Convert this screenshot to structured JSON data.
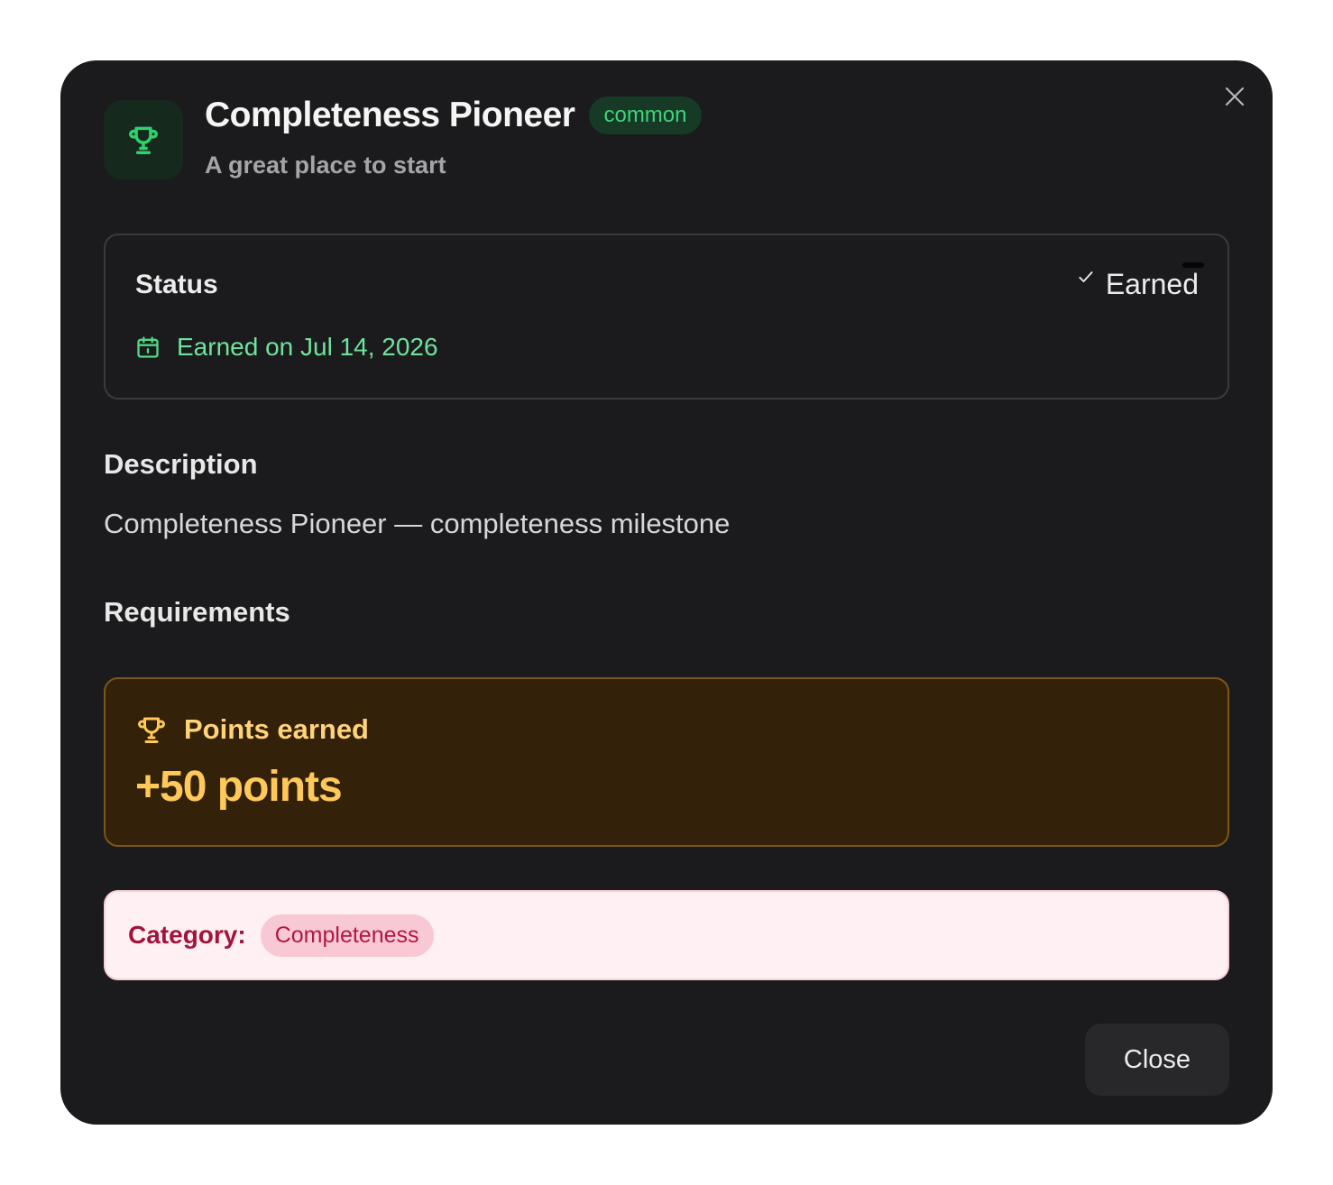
{
  "achievement": {
    "title": "Completeness Pioneer",
    "rarity": "common",
    "subtitle": "A great place to start",
    "icon": "trophy-icon"
  },
  "status": {
    "label": "Status",
    "state": "Earned",
    "earned_text": "Earned on Jul 14, 2026",
    "icon": "calendar-icon"
  },
  "description": {
    "heading": "Description",
    "text": "Completeness Pioneer — completeness milestone"
  },
  "requirements": {
    "heading": "Requirements"
  },
  "points": {
    "label": "Points earned",
    "value": "+50 points",
    "icon": "trophy-icon"
  },
  "category": {
    "label": "Category:",
    "value": "Completeness"
  },
  "footer": {
    "close_label": "Close"
  },
  "colors": {
    "modal_bg": "#1b1b1d",
    "success": "#3ed47a",
    "points_accent": "#ffc85a",
    "category_accent": "#a3143c"
  }
}
